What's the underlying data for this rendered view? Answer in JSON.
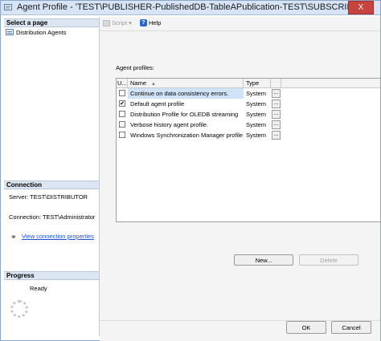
{
  "window": {
    "title": "Agent Profile - 'TEST\\PUBLISHER-PublishedDB-TableAPublication-TEST\\SUBSCRIBE...",
    "close_label": "X"
  },
  "left_panel": {
    "select_page_header": "Select a page",
    "pages": [
      {
        "label": "Distribution Agents",
        "icon": "page-icon"
      }
    ],
    "connection_header": "Connection",
    "server": "Server: TEST\\DISTRIBUTOR",
    "connection": "Connection: TEST\\Administrator",
    "view_connection_link": "View connection properties",
    "progress_header": "Progress",
    "progress_status": "Ready"
  },
  "toolbar": {
    "script_label": "Script",
    "script_dropdown": "▾",
    "help_label": "Help"
  },
  "profiles": {
    "label": "Agent profiles:",
    "columns": {
      "use": "U...",
      "name": "Name",
      "type": "Type"
    },
    "rows": [
      {
        "checked": false,
        "name": "Continue on data consistency errors.",
        "type": "System",
        "selected": true
      },
      {
        "checked": true,
        "name": "Default agent profile",
        "type": "System",
        "selected": false
      },
      {
        "checked": false,
        "name": "Distribution Profile for OLEDB streaming",
        "type": "System",
        "selected": false
      },
      {
        "checked": false,
        "name": "Verbose history agent profile.",
        "type": "System",
        "selected": false
      },
      {
        "checked": false,
        "name": "Windows Synchronization Manager profile",
        "type": "System",
        "selected": false
      }
    ],
    "ellipsis_label": "..."
  },
  "buttons": {
    "new": "New...",
    "delete": "Delete",
    "ok": "OK",
    "cancel": "Cancel"
  },
  "colors": {
    "titlebar": "#d6e4f5",
    "selection": "#cfe2f7",
    "link": "#1a4fd6",
    "close": "#c7433d"
  }
}
